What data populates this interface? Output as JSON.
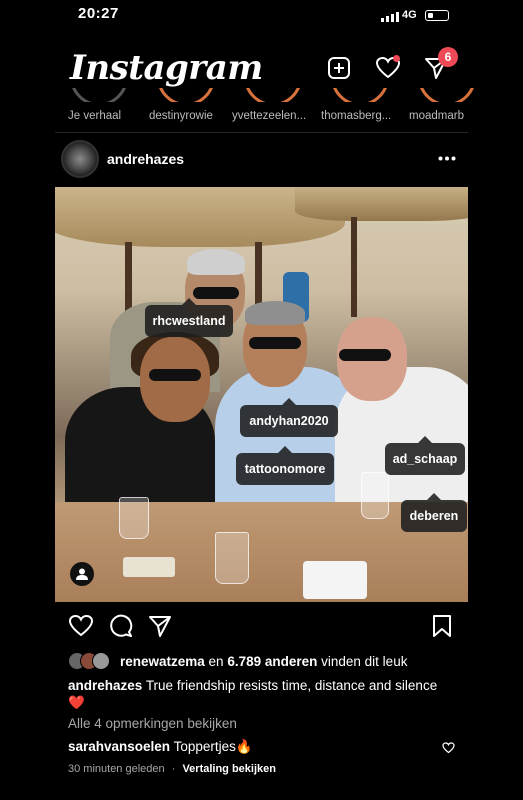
{
  "status_bar": {
    "time": "20:27",
    "network": "4G"
  },
  "header": {
    "logo": "Instagram",
    "activity_badge": "6"
  },
  "stories": [
    {
      "label": "Je verhaal"
    },
    {
      "label": "destinyrowie"
    },
    {
      "label": "yvettezeelen..."
    },
    {
      "label": "thomasberg..."
    },
    {
      "label": "moadmarb"
    }
  ],
  "post": {
    "username": "andrehazes",
    "tags": {
      "tag1": "rhcwestland",
      "tag2": "andyhan2020",
      "tag3": "tattoonomore",
      "tag4": "ad_schaap",
      "tag5": "deberen"
    },
    "likes": {
      "first_user": "renewatzema",
      "connector": " en ",
      "others": "6.789 anderen",
      "suffix": " vinden dit leuk"
    },
    "caption": {
      "username": "andrehazes",
      "text": "True friendship resists time, distance and silence",
      "emoji": "❤️"
    },
    "view_comments": "Alle 4 opmerkingen bekijken",
    "comment": {
      "username": "sarahvansoelen",
      "text": "Toppertjes",
      "emoji": "🔥"
    },
    "time_ago": "30 minuten geleden",
    "separator": "·",
    "translate": "Vertaling bekijken"
  },
  "colors": {
    "accent_red": "#ed4956",
    "story_ring": "#d8723d",
    "muted_text": "#a8a8a8"
  }
}
